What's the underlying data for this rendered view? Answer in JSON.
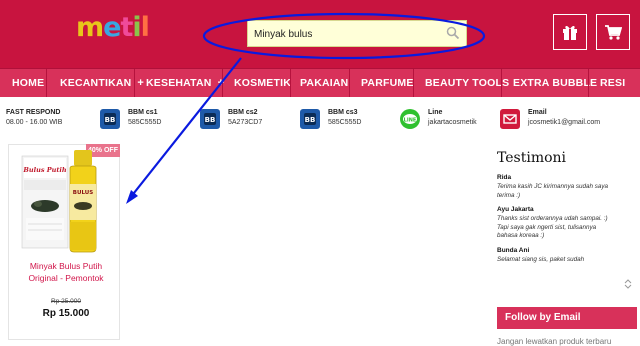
{
  "header": {
    "logo": [
      "m",
      "e",
      "t",
      "i",
      "l"
    ],
    "search_value": "Minyak bulus"
  },
  "nav": [
    "HOME",
    "KECANTIKAN",
    "KESEHATAN",
    "KOSMETIK",
    "PAKAIAN",
    "PARFUME",
    "BEAUTY TOOLS",
    "EXTRA BUBBLE",
    "RESI"
  ],
  "nav_plus": "+",
  "contacts": [
    {
      "title": "FAST RESPOND",
      "value": "08.00 - 16.00 WIB",
      "icon": "none"
    },
    {
      "title": "BBM cs1",
      "value": "585C555D",
      "icon": "bbm-icon"
    },
    {
      "title": "BBM cs2",
      "value": "5A273CD7",
      "icon": "bbm-icon"
    },
    {
      "title": "BBM cs3",
      "value": "585C555D",
      "icon": "bbm-icon"
    },
    {
      "title": "Line",
      "value": "jakartacosmetik",
      "icon": "line-icon"
    },
    {
      "title": "Email",
      "value": "jcosmetik1@gmail.com",
      "icon": "mail-icon"
    }
  ],
  "product": {
    "badge": "40% OFF",
    "name": "Minyak Bulus Putih Original - Pemontok",
    "old_price": "Rp 25.000",
    "price": "Rp 15.000"
  },
  "testimoni": {
    "title": "Testimoni",
    "items": [
      {
        "name": "Rida",
        "text": "Terima kasih JC kirimannya sudah saya terima :)"
      },
      {
        "name": "Ayu Jakarta",
        "text": "Thanks sist orderannya udah sampai. :) Tapi saya gak ngerti sist, tulisannya bahasa koreaa :)"
      },
      {
        "name": "Bunda Ani",
        "text": "Selamat siang sis, paket sudah"
      }
    ]
  },
  "follow": {
    "title": "Follow by Email",
    "text": "Jangan lewatkan produk terbaru"
  },
  "colors": {
    "brand": "#c8143f",
    "nav": "#d8315a",
    "annotation": "#0a1adf"
  }
}
